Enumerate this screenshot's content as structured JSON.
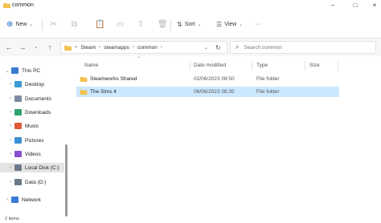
{
  "window": {
    "title": "common"
  },
  "toolbar": {
    "new_label": "New",
    "sort_label": "Sort",
    "view_label": "View",
    "more_label": "···"
  },
  "address": {
    "segments": [
      "Steam",
      "steamapps",
      "common"
    ],
    "prefix": "«"
  },
  "search": {
    "placeholder": "Search common"
  },
  "sidebar": {
    "items": [
      {
        "label": "This PC",
        "icon": "pc-icon",
        "color": "#3a7bd5"
      },
      {
        "label": "Desktop",
        "icon": "desktop-icon",
        "color": "#3a9bd5"
      },
      {
        "label": "Documents",
        "icon": "documents-icon",
        "color": "#7a8aa0"
      },
      {
        "label": "Downloads",
        "icon": "downloads-icon",
        "color": "#2fa36b"
      },
      {
        "label": "Music",
        "icon": "music-icon",
        "color": "#e05a3a"
      },
      {
        "label": "Pictures",
        "icon": "pictures-icon",
        "color": "#3a8fd5"
      },
      {
        "label": "Videos",
        "icon": "videos-icon",
        "color": "#8a4fd0"
      },
      {
        "label": "Local Disk (C:)",
        "icon": "drive-icon",
        "color": "#6a7a8a"
      },
      {
        "label": "Data (D:)",
        "icon": "drive-icon",
        "color": "#6a7a8a"
      },
      {
        "label": "Network",
        "icon": "network-icon",
        "color": "#3a7bd5"
      }
    ]
  },
  "columns": {
    "name": "Name",
    "date": "Date modified",
    "type": "Type",
    "size": "Size"
  },
  "files": [
    {
      "name": "Steamworks Shared",
      "date": "02/06/2023 08:50",
      "type": "File folder",
      "size": ""
    },
    {
      "name": "The Sims 4",
      "date": "06/06/2023 08:35",
      "type": "File folder",
      "size": ""
    }
  ],
  "status": {
    "text": "2 items"
  },
  "colors": {
    "folder": "#f2c14e",
    "selection": "#cce8ff"
  }
}
